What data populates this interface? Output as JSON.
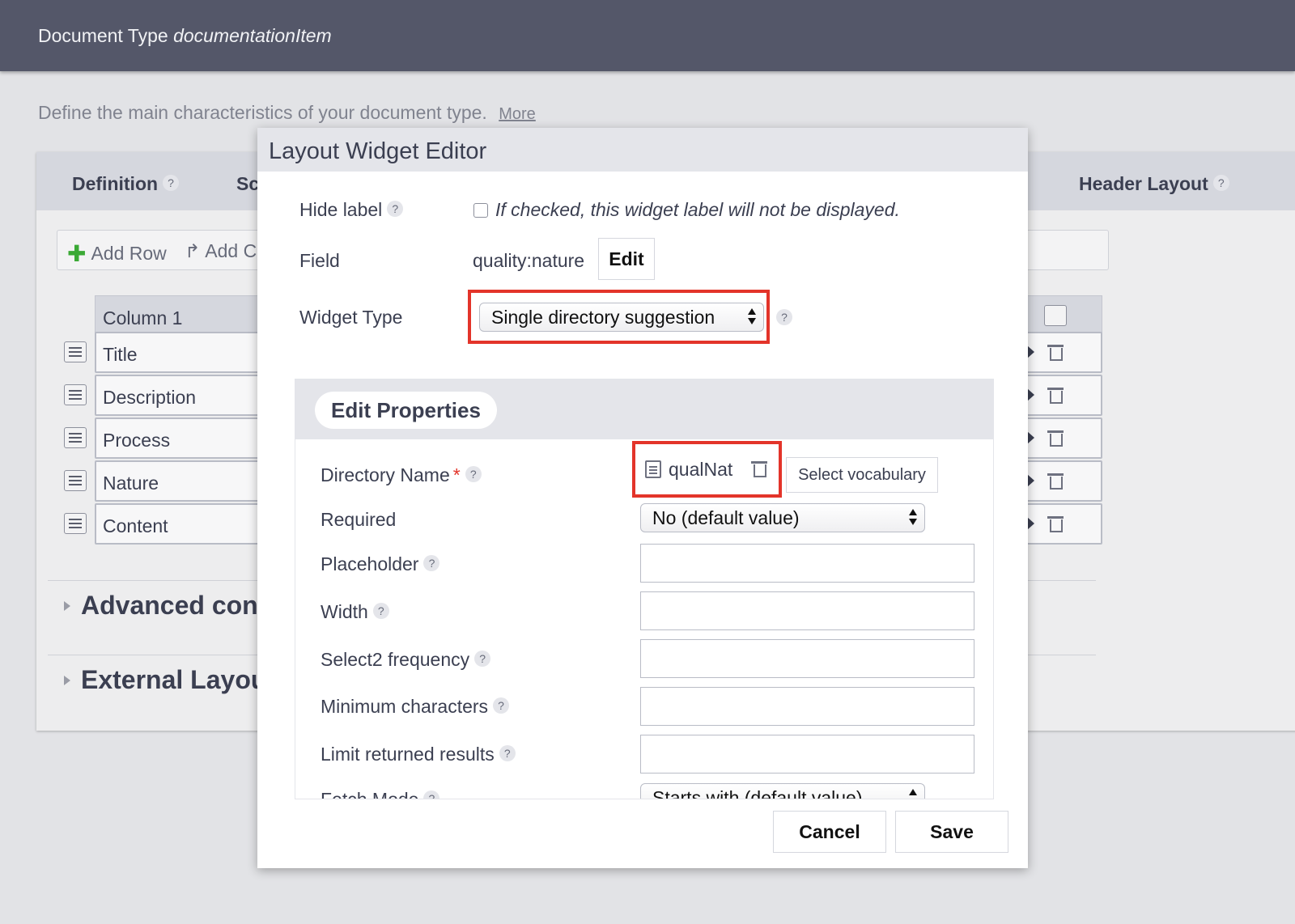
{
  "header": {
    "prefix": "Document Type",
    "doc_type": "documentationItem"
  },
  "intro": {
    "text": "Define the main characteristics of your document type.",
    "more_link": "More"
  },
  "tabs": [
    {
      "label": "Definition"
    },
    {
      "label": "Sc"
    },
    {
      "label": "Header Layout"
    }
  ],
  "toolbar": {
    "add_row": "Add Row",
    "add_column": "Add C"
  },
  "layout_table": {
    "column_header": "Column 1",
    "rows": [
      "Title",
      "Description",
      "Process",
      "Nature",
      "Content"
    ]
  },
  "sections": [
    {
      "title": "Advanced conf"
    },
    {
      "title": "External Layou"
    }
  ],
  "dialog": {
    "title": "Layout Widget Editor",
    "hide_label": {
      "label": "Hide label",
      "hint": "If checked, this widget label will not be displayed.",
      "checked": false
    },
    "field": {
      "label": "Field",
      "value": "quality:nature",
      "edit_button": "Edit"
    },
    "widget_type": {
      "label": "Widget Type",
      "selected": "Single directory suggestion"
    },
    "properties": {
      "title": "Edit Properties",
      "directory_name": {
        "label": "Directory Name",
        "required_marker": "*",
        "value": "qualNat",
        "select_button": "Select vocabulary"
      },
      "required": {
        "label": "Required",
        "selected": "No (default value)"
      },
      "placeholder": {
        "label": "Placeholder",
        "value": ""
      },
      "width": {
        "label": "Width",
        "value": ""
      },
      "select2_frequency": {
        "label": "Select2 frequency",
        "value": ""
      },
      "minimum_characters": {
        "label": "Minimum characters",
        "value": ""
      },
      "limit_returned_results": {
        "label": "Limit returned results",
        "value": ""
      },
      "fetch_mode": {
        "label": "Fetch Mode",
        "selected": "Starts with (default value)"
      }
    },
    "help_glyph": "?",
    "cancel_button": "Cancel",
    "save_button": "Save"
  },
  "colors": {
    "topbar": "#545769",
    "highlight": "#e3342a",
    "add_icon": "#3aa935"
  }
}
